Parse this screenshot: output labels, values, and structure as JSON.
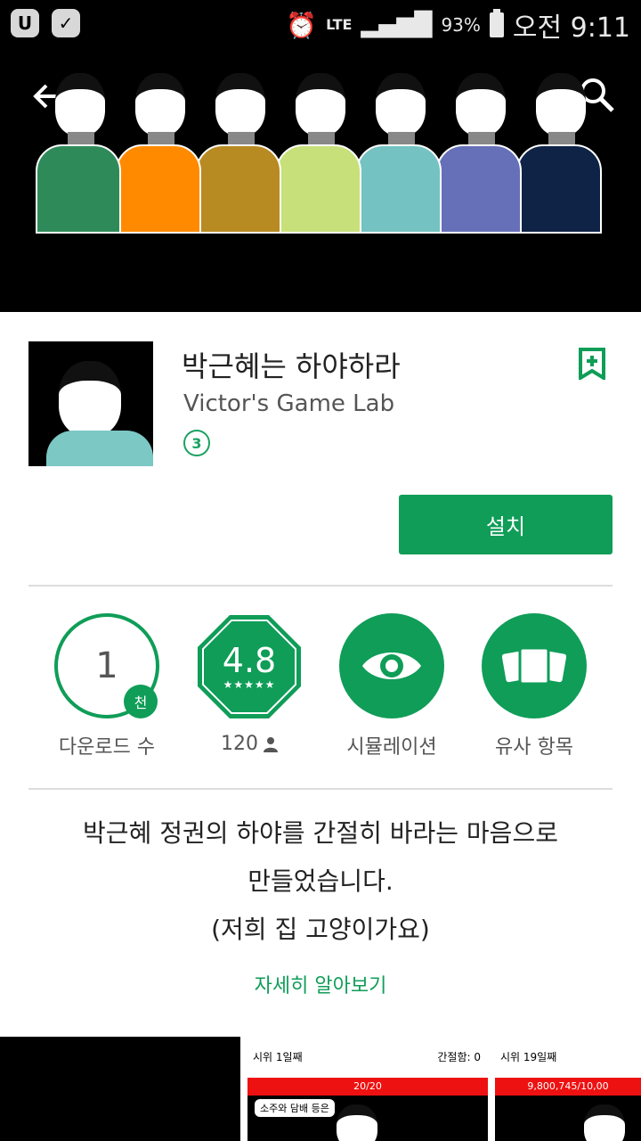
{
  "status": {
    "battery": "93%",
    "time": "오전 9:11",
    "network": "LTE",
    "notif_icon_1": "U",
    "notif_icon_2": "✓"
  },
  "banner": {
    "hoodie_colors": [
      "#2f8a5a",
      "#ff8a00",
      "#b88a22",
      "#c7e07a",
      "#75c2c2",
      "#6670b8",
      "#0f2347"
    ]
  },
  "app": {
    "title": "박근혜는 하야하라",
    "developer": "Victor's Game Lab",
    "content_rating": "3",
    "install_label": "설치"
  },
  "stats": {
    "downloads_value": "1",
    "downloads_unit": "천",
    "downloads_label": "다운로드 수",
    "rating_value": "4.8",
    "rating_stars": "★★★★★",
    "reviews_count": "120",
    "category_label": "시뮬레이션",
    "similar_label": "유사 항목"
  },
  "description": {
    "line1": "박근혜 정권의 하야를 간절히 바라는 마음으로",
    "line2": "만들었습니다.",
    "line3": "(저희 집 고양이가요)",
    "more_label": "자세히 알아보기"
  },
  "screenshots": [
    {
      "day": "시위 1일째",
      "stat": "간절함: 0",
      "bar": "20/20",
      "tag": "소주와 담배 등은"
    },
    {
      "day": "시위 19일째",
      "stat": "",
      "bar": "9,800,745/10,00",
      "tag": ""
    }
  ],
  "colors": {
    "accent": "#0f9d58"
  }
}
